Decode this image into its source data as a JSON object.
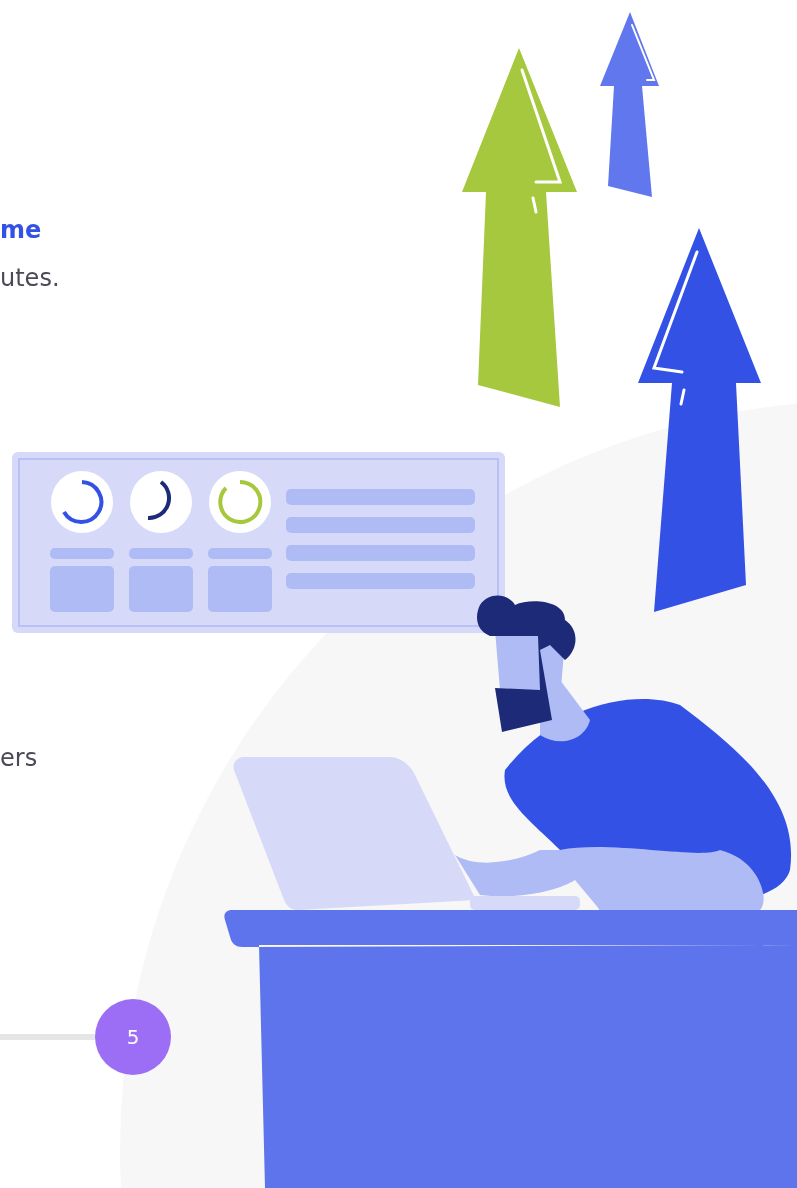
{
  "heading_fragment": "me",
  "text_fragment": "utes.",
  "text_fragment_2": "ers",
  "progress_step": {
    "label": "5"
  }
}
